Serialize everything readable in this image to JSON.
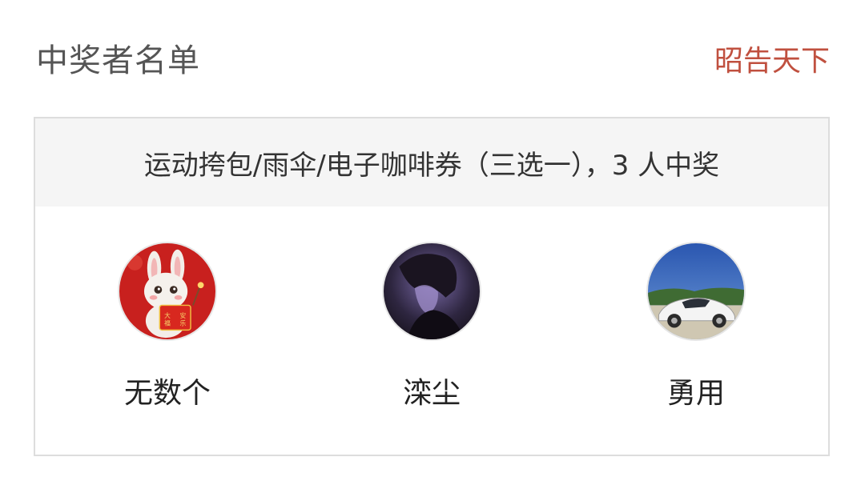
{
  "header": {
    "title": "中奖者名单",
    "action_label": "昭告天下"
  },
  "prize": {
    "description": "运动挎包/雨伞/电子咖啡券（三选一），3 人中奖"
  },
  "winners": [
    {
      "name": "无数个",
      "avatar_icon": "rabbit-avatar-icon"
    },
    {
      "name": "滦尘",
      "avatar_icon": "dark-figure-avatar-icon"
    },
    {
      "name": "勇用",
      "avatar_icon": "car-avatar-icon"
    }
  ],
  "colors": {
    "accent": "#c0503f",
    "title_text": "#555555",
    "prize_bar_bg": "#f5f5f5",
    "card_border": "#dddddd"
  }
}
